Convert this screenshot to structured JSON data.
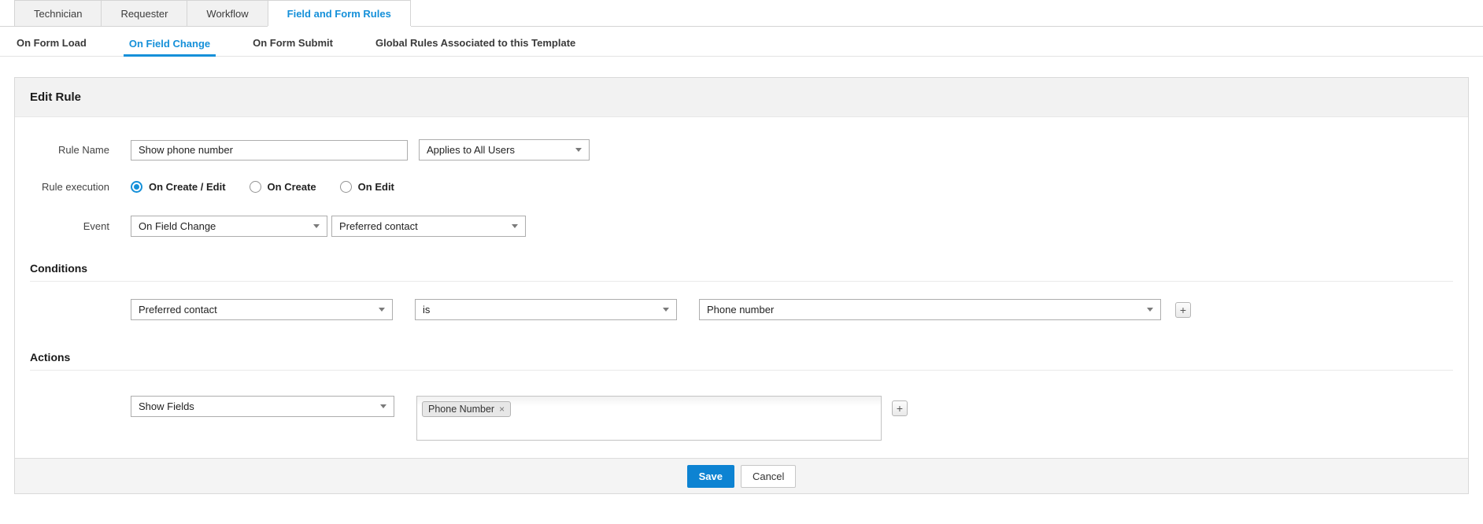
{
  "tabs": {
    "items": [
      {
        "label": "Technician",
        "active": false
      },
      {
        "label": "Requester",
        "active": false
      },
      {
        "label": "Workflow",
        "active": false
      },
      {
        "label": "Field and Form Rules",
        "active": true
      }
    ]
  },
  "subtabs": {
    "items": [
      {
        "label": "On Form Load",
        "active": false
      },
      {
        "label": "On Field Change",
        "active": true
      },
      {
        "label": "On Form Submit",
        "active": false
      },
      {
        "label": "Global Rules Associated to this Template",
        "active": false
      }
    ]
  },
  "panel": {
    "title": "Edit Rule",
    "rule_name": {
      "label": "Rule Name",
      "value": "Show phone number"
    },
    "applies_to": {
      "value": "Applies to All Users"
    },
    "rule_execution": {
      "label": "Rule execution",
      "options": [
        {
          "label": "On Create / Edit",
          "selected": true
        },
        {
          "label": "On Create",
          "selected": false
        },
        {
          "label": "On Edit",
          "selected": false
        }
      ]
    },
    "event": {
      "label": "Event",
      "type_value": "On Field Change",
      "field_value": "Preferred contact"
    },
    "conditions": {
      "heading": "Conditions",
      "rows": [
        {
          "field": "Preferred contact",
          "operator": "is",
          "value": "Phone number"
        }
      ],
      "add_label": "+"
    },
    "actions": {
      "heading": "Actions",
      "rows": [
        {
          "action": "Show Fields",
          "chips": [
            {
              "label": "Phone Number",
              "remove_icon": "×"
            }
          ]
        }
      ],
      "add_label": "+"
    },
    "footer": {
      "save_label": "Save",
      "cancel_label": "Cancel"
    }
  },
  "colors": {
    "accent_blue": "#1590d9",
    "save_blue": "#0d83d2",
    "tab_inactive_bg": "#f1f1f1",
    "panel_header_bg": "#f2f2f2",
    "footer_bg": "#f4f4f4"
  }
}
